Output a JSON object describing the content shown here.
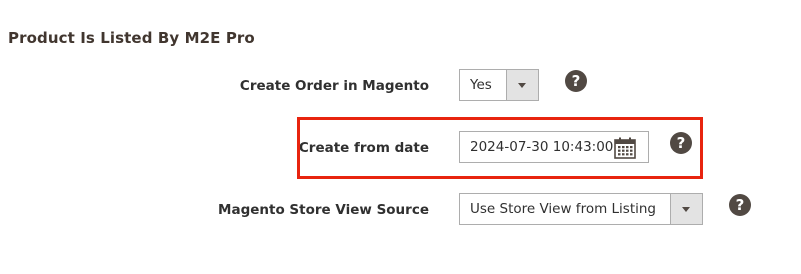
{
  "section": {
    "title": "Product Is Listed By M2E Pro"
  },
  "fields": {
    "create_order": {
      "label": "Create Order in Magento",
      "value": "Yes",
      "help": "?"
    },
    "create_from_date": {
      "label": "Create from date",
      "value": "2024-07-30 10:43:00",
      "help": "?"
    },
    "store_view_source": {
      "label": "Magento Store View Source",
      "value": "Use Store View from Listing",
      "help": "?"
    }
  },
  "colors": {
    "highlight": "#e8240f",
    "help_icon_bg": "#514943",
    "select_arrow_bg": "#e3e3e3"
  }
}
